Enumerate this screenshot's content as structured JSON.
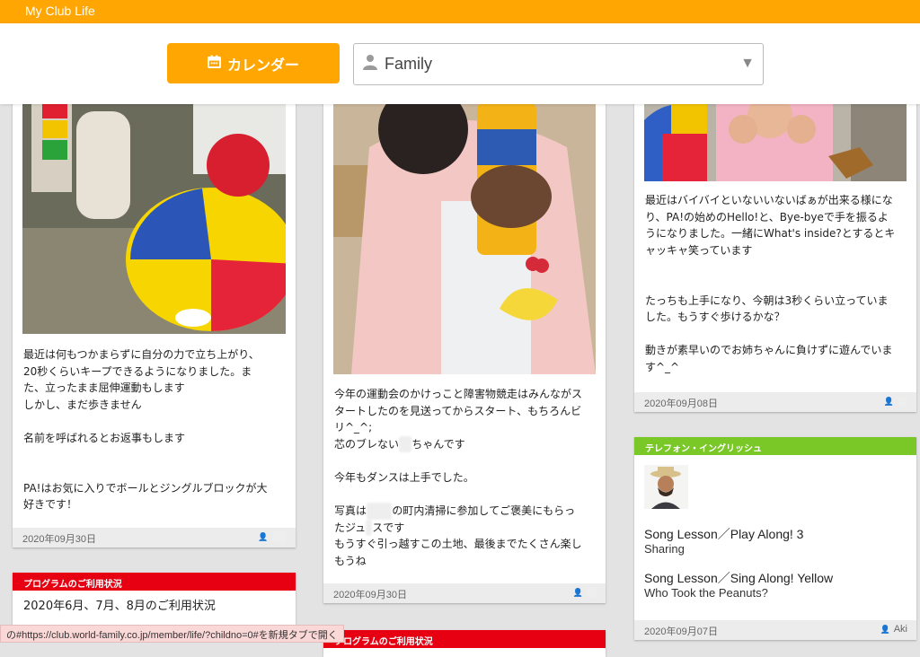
{
  "app": {
    "brand": "My Club Life"
  },
  "toolbar": {
    "calendar_label": "カレンダー",
    "family_select_value": "Family"
  },
  "cards": {
    "c1": {
      "text": "最近は何もつかまらずに自分の力で立ち上がり、\n20秒くらいキープできるようになりました。ま\nた、立ったまま屈伸運動もします\nしかし、まだ歩きません\n\n名前を呼ばれるとお返事もします\n\n\nPA!はお気に入りでボールとジングルブロックが大\n好きです！",
      "date": "2020年09月30日"
    },
    "c2": {
      "text_line1": "今年の運動会のかけっこと障害物競走はみんながス",
      "text_line2": "タートしたのを見送ってからスタート、もちろんビ",
      "text_line3": "リ^_^;",
      "text_line4a": "芯のブレない",
      "text_line4b": "ちゃんです",
      "text_line5": "今年もダンスは上手でした。",
      "text_line6a": "写真は",
      "text_line6b": "の町内清掃に参加してご褒美にもらっ",
      "text_line7": "たジュ",
      "text_line7b": "スです",
      "text_line8": "もうすぐ引っ越すこの土地、最後までたくさん楽し",
      "text_line9": "もうね",
      "date": "2020年09月30日"
    },
    "c3": {
      "text": "最近はバイバイといないいないばぁが出来る様にな\nり、PA!の始めのHello!と、Bye-byeで手を振るよ\nうになりました。一緒にWhat's inside?とするとキ\nャッキャ笑っています\n\n\nたっちも上手になり、今朝は3秒くらい立っていま\nした。もうすぐ歩けるかな？\n\n動きが素早いのでお姉ちゃんに負けずに遊んでいま\nす^_^",
      "date": "2020年09月08日"
    },
    "program": {
      "tag": "プログラムのご利用状況",
      "text": "2020年6月、7月、8月のご利用状況"
    },
    "program2": {
      "tag": "プログラムのご利用状況"
    },
    "telephone": {
      "tag": "テレフォン・イングリッシュ",
      "song1_title": "Song Lesson／Play Along! 3",
      "song1_sub": "Sharing",
      "song2_title": "Song Lesson／Sing Along! Yellow",
      "song2_sub": "Who Took the Peanuts?",
      "date": "2020年09月07日",
      "author": "Aki"
    }
  },
  "status_url": "の#https://club.world-family.co.jp/member/life/?childno=0#を新規タブで開く",
  "colors": {
    "accent": "#ffa602",
    "red": "#e60012",
    "green": "#7ac828"
  },
  "icons": [
    "calendar-icon",
    "person-icon",
    "chevron-down-icon",
    "user-icon"
  ]
}
